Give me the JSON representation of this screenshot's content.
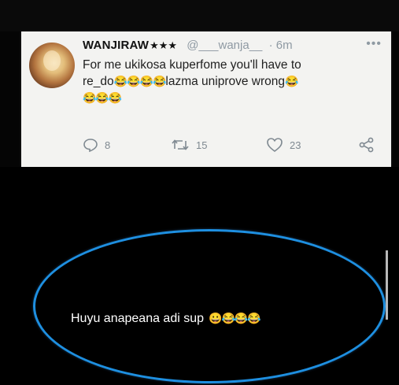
{
  "tweet": {
    "display_name": "WANJIRAW",
    "stars": "★★★",
    "handle": "@___wanja__",
    "time": "· 6m",
    "text_line1": "For me ukikosa kuperfome you'll have to",
    "text_line2_start": "re_do",
    "emojis_a": "😂😂😂😂",
    "text_line2_end": "lazma uniprove wrong",
    "emoji_b": "😂",
    "emojis_c": "😂😂😂",
    "actions": {
      "reply_count": "8",
      "retweet_count": "15",
      "like_count": "23"
    }
  },
  "caption": {
    "text": "Huyu anapeana adi sup",
    "emojis": "😀😂😂😂"
  },
  "icons": {
    "reply": "reply-icon",
    "retweet": "retweet-icon",
    "like": "heart-icon",
    "share": "share-icon",
    "more": "more-icon"
  },
  "colors": {
    "background": "#050505",
    "card": "#f3f3f1",
    "oval": "#1e8fe0",
    "meta_gray": "#8f9aa3"
  }
}
